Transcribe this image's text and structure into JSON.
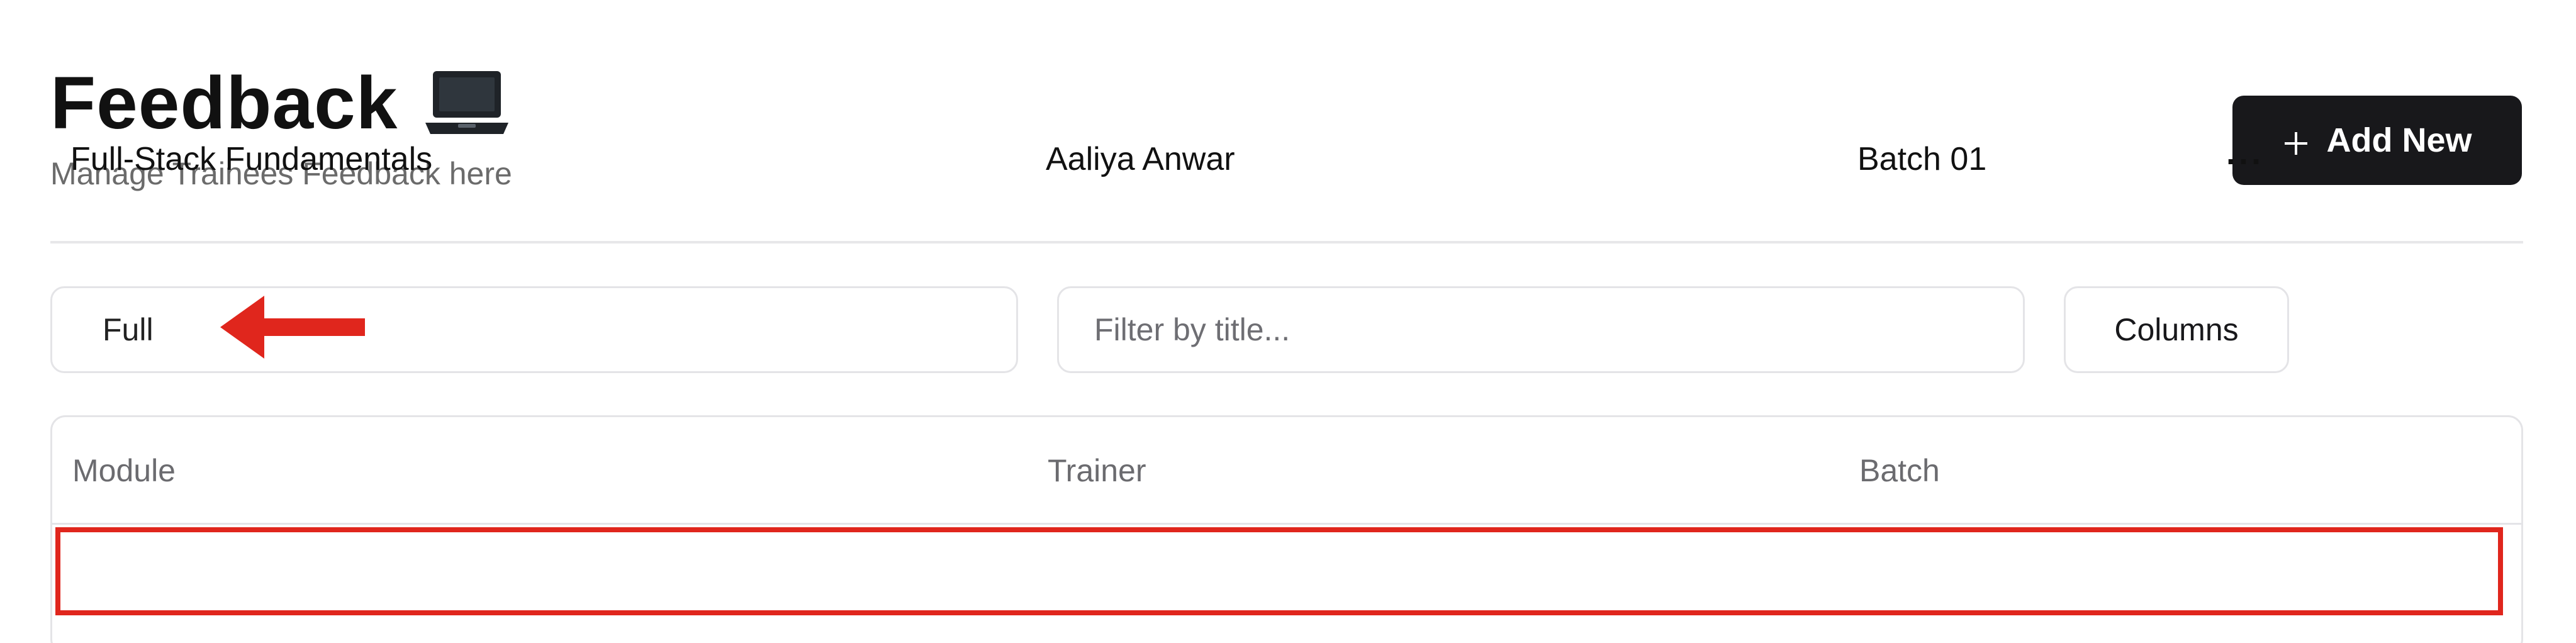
{
  "header": {
    "title": "Feedback",
    "title_icon": "laptop-icon",
    "subtitle": "Manage Trainees Feedback here",
    "add_button_label": "Add New",
    "add_button_icon": "plus-icon"
  },
  "filters": {
    "module_filter_value": "Full",
    "title_filter_placeholder": "Filter by title...",
    "columns_button_label": "Columns"
  },
  "table": {
    "columns": [
      "Module",
      "Trainer",
      "Batch"
    ],
    "rows": [
      {
        "module": "Full-Stack Fundamentals",
        "trainer": "Aaliya Anwar",
        "batch": "Batch 01",
        "actions": "···"
      }
    ]
  },
  "annotations": {
    "arrow_color": "#e0261d",
    "highlight_color": "#e0261d"
  },
  "colors": {
    "primary_button_bg": "#18181b",
    "border": "#e4e4e7",
    "muted_text": "#6b6b6b"
  }
}
